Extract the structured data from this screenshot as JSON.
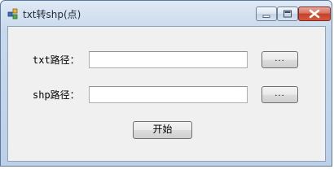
{
  "window": {
    "title": "txt转shp(点)",
    "controls": {
      "minimize": "minimize",
      "maximize": "maximize",
      "close": "close"
    }
  },
  "form": {
    "txt_label": "txt路径：",
    "txt_path_value": "",
    "txt_browse_label": "...",
    "shp_label": "shp路径：",
    "shp_path_value": "",
    "shp_browse_label": "...",
    "start_label": "开始"
  }
}
